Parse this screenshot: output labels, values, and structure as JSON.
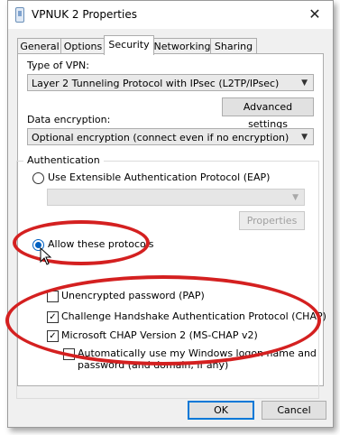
{
  "window": {
    "title": "VPNUK 2 Properties",
    "close_glyph": "✕"
  },
  "tabs": [
    {
      "label": "General"
    },
    {
      "label": "Options"
    },
    {
      "label": "Security",
      "active": true
    },
    {
      "label": "Networking"
    },
    {
      "label": "Sharing"
    }
  ],
  "security": {
    "vpn_type_label": "Type of VPN:",
    "vpn_type_value": "Layer 2 Tunneling Protocol with IPsec (L2TP/IPsec)",
    "advanced_settings_label": "Advanced settings",
    "encryption_label": "Data encryption:",
    "encryption_value": "Optional encryption (connect even if no encryption)",
    "auth_group_label": "Authentication",
    "eap_label": "Use Extensible Authentication Protocol (EAP)",
    "eap_value": "",
    "properties_label": "Properties",
    "allow_protocols_label": "Allow these protocols",
    "pap_label": "Unencrypted password (PAP)",
    "pap_checked": false,
    "chap_label": "Challenge Handshake Authentication Protocol (CHAP)",
    "chap_checked": true,
    "mschap_label": "Microsoft CHAP Version 2 (MS-CHAP v2)",
    "mschap_checked": true,
    "autologon_label_line1": "Automatically use my Windows logon name and",
    "autologon_label_line2": "password (and domain, if any)",
    "autologon_checked": false
  },
  "footer": {
    "ok_label": "OK",
    "cancel_label": "Cancel"
  },
  "annotation_color": "#d42020",
  "accent_color": "#0078d7"
}
